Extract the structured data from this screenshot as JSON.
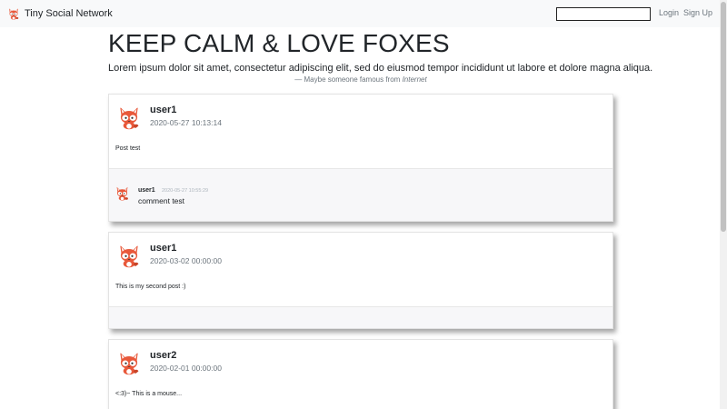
{
  "navbar": {
    "brand": "Tiny Social Network",
    "search_value": "",
    "login_label": "Login",
    "signup_label": "Sign Up"
  },
  "hero": {
    "title": "KEEP CALM & LOVE FOXES",
    "lead": "Lorem ipsum dolor sit amet, consectetur adipiscing elit, sed do eiusmod tempor incididunt ut labore et dolore magna aliqua.",
    "cite_prefix": "— Maybe someone famous from ",
    "cite_source": "Internet"
  },
  "posts": [
    {
      "user": "user1",
      "date": "2020-05-27 10:13:14",
      "text": "Post test",
      "comments": [
        {
          "user": "user1",
          "date": "2020-05-27 10:55:29",
          "text": "comment test"
        }
      ]
    },
    {
      "user": "user1",
      "date": "2020-03-02 00:00:00",
      "text": "This is my second post :)",
      "comments": []
    },
    {
      "user": "user2",
      "date": "2020-02-01 00:00:00",
      "text": "<:3)~ This is a mouse...",
      "comments": []
    }
  ],
  "colors": {
    "fox_orange": "#e8583a",
    "navbar_bg": "#f8f9fa",
    "muted_text": "#6c757d"
  },
  "icons": {
    "brand": "fox-logo-icon",
    "avatar": "fox-avatar-icon"
  }
}
